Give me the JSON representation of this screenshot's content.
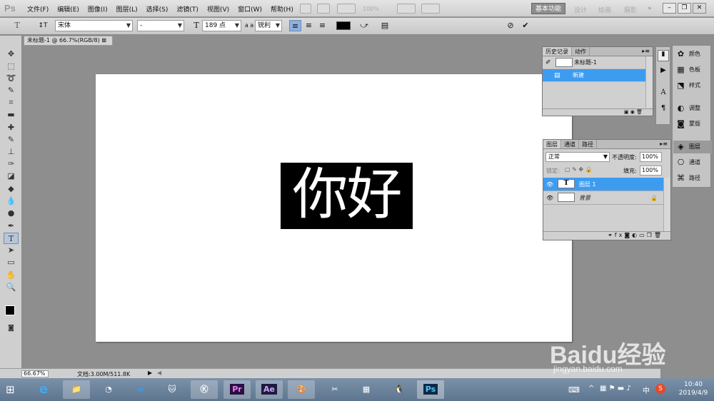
{
  "app": {
    "logo": "Ps"
  },
  "menu": [
    "文件(F)",
    "编辑(E)",
    "图像(I)",
    "图层(L)",
    "选择(S)",
    "滤镜(T)",
    "视图(V)",
    "窗口(W)",
    "帮助(H)"
  ],
  "zoom_menu": "100%",
  "workspace": {
    "active": "基本功能",
    "others": [
      "设计",
      "绘画",
      "摄影"
    ],
    "more": "»"
  },
  "options": {
    "font_family": "宋体",
    "font_style": "-",
    "font_size": "189 点",
    "aa_label": "a a",
    "anti_alias": "锐利",
    "cancel_glyph": "⊘",
    "commit_glyph": "✔"
  },
  "document": {
    "tab": "未标题-1 @ 66.7%(RGB/8)",
    "text": "你好"
  },
  "status": {
    "zoom": "66.67%",
    "doc_info": "文档:3.00M/511.8K"
  },
  "history_panel": {
    "tabs": [
      "历史记录",
      "动作"
    ],
    "snapshot": "未标题-1",
    "items": [
      "新建"
    ]
  },
  "layers_panel": {
    "tabs": [
      "图层",
      "通道",
      "路径"
    ],
    "blend_mode": "正常",
    "opacity_label": "不透明度:",
    "opacity": "100%",
    "lock_label": "锁定:",
    "fill_label": "填充:",
    "fill": "100%",
    "layers": [
      {
        "name": "图层 1",
        "thumb": "T",
        "selected": true
      },
      {
        "name": "背景",
        "thumb": "",
        "selected": false
      }
    ]
  },
  "dock": [
    {
      "label": "颜色",
      "icon": "color-icon"
    },
    {
      "label": "色板",
      "icon": "swatches-icon"
    },
    {
      "label": "样式",
      "icon": "styles-icon"
    },
    {
      "label": "调整",
      "icon": "adjustments-icon"
    },
    {
      "label": "蒙版",
      "icon": "masks-icon"
    },
    {
      "label": "图层",
      "icon": "layers-icon"
    },
    {
      "label": "通道",
      "icon": "channels-icon"
    },
    {
      "label": "路径",
      "icon": "paths-icon"
    }
  ],
  "taskbar": {
    "time": "10:40",
    "date": "2019/4/9",
    "ime": "中",
    "apps": [
      "Pr",
      "Ae",
      "Ps"
    ]
  },
  "watermark": {
    "brand": "Baidu经验",
    "url": "jingyan.baidu.com"
  },
  "colors": {
    "selection": "#3e9cf0",
    "accent": "#1c7fd6"
  }
}
